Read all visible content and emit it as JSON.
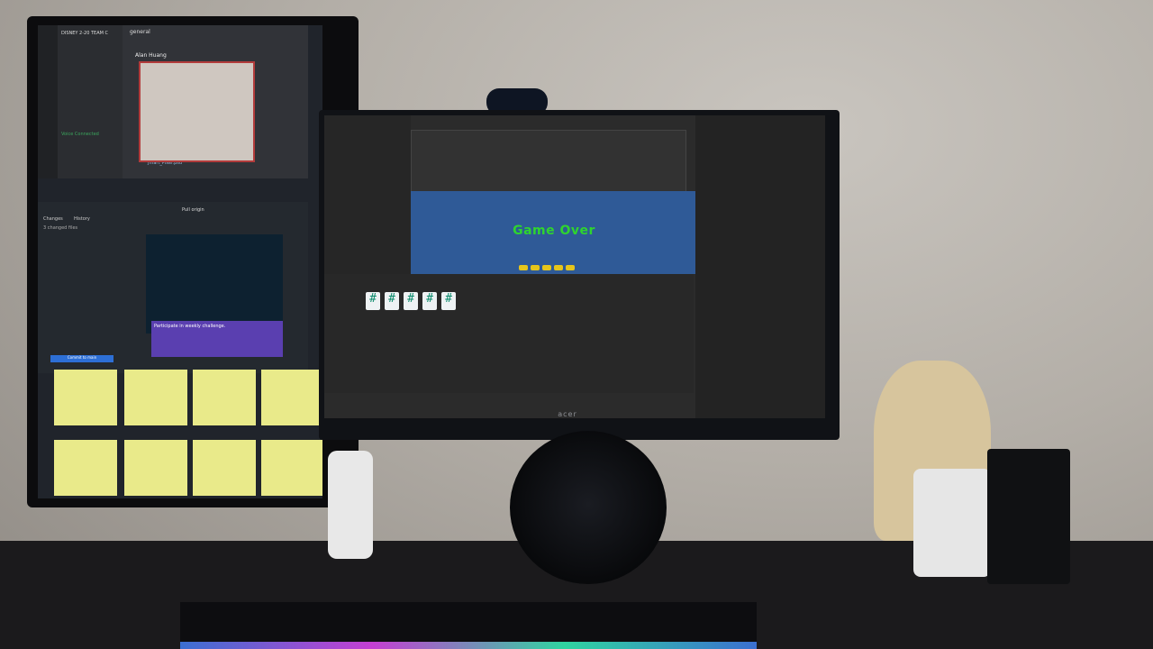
{
  "left_monitor": {
    "discord": {
      "server_name": "DISNEY 2-20 TEAM C",
      "channel": "general",
      "user": "Alan Huang",
      "voice_status": "Voice Connected",
      "file": "Jmart_Pixel.psd"
    },
    "github": {
      "changes_label": "Changes",
      "history_label": "History",
      "changed_files": "3 changed files",
      "commit_button": "Commit to main",
      "pull_origin": "Pull origin"
    },
    "purple_note": "Participate in weekly challenge."
  },
  "right_monitor": {
    "game_text": "Game Over",
    "brand": "acer",
    "project_scripts": 5
  },
  "colors": {
    "wall": "#b3aea7",
    "game_bg": "#2f5a97",
    "game_text": "#2fd42f",
    "sticky": "#e9ea8a"
  }
}
